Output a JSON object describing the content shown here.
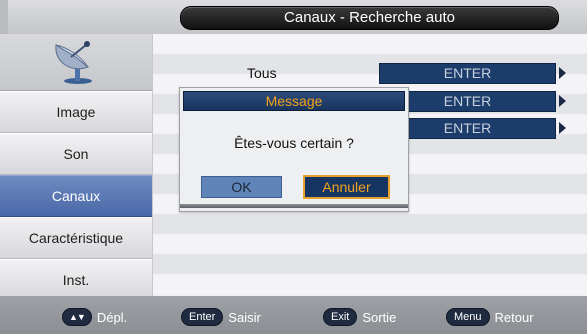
{
  "header": {
    "title": "Canaux - Recherche auto"
  },
  "sidebar": {
    "logo_icon": "satellite-dish-icon",
    "items": [
      {
        "label": "Image",
        "active": false
      },
      {
        "label": "Son",
        "active": false
      },
      {
        "label": "Canaux",
        "active": true
      },
      {
        "label": "Caractéristique",
        "active": false
      },
      {
        "label": "Inst.",
        "active": false
      }
    ]
  },
  "main": {
    "rows": [
      {
        "label": "Tous",
        "value": "ENTER"
      },
      {
        "label": "",
        "value": "ENTER"
      },
      {
        "label": "",
        "value": "ENTER"
      }
    ]
  },
  "dialog": {
    "title": "Message",
    "message": "Êtes-vous certain ?",
    "ok_label": "OK",
    "cancel_label": "Annuler"
  },
  "footer": {
    "hints": [
      {
        "key": "▲▼",
        "label": "Dépl."
      },
      {
        "key": "Enter",
        "label": "Saisir"
      },
      {
        "key": "Exit",
        "label": "Sortie"
      },
      {
        "key": "Menu",
        "label": "Retour"
      }
    ]
  },
  "colors": {
    "accent_orange": "#f2a21a",
    "active_tab": "#5a78b4",
    "field_blue": "#1c3d6b"
  }
}
